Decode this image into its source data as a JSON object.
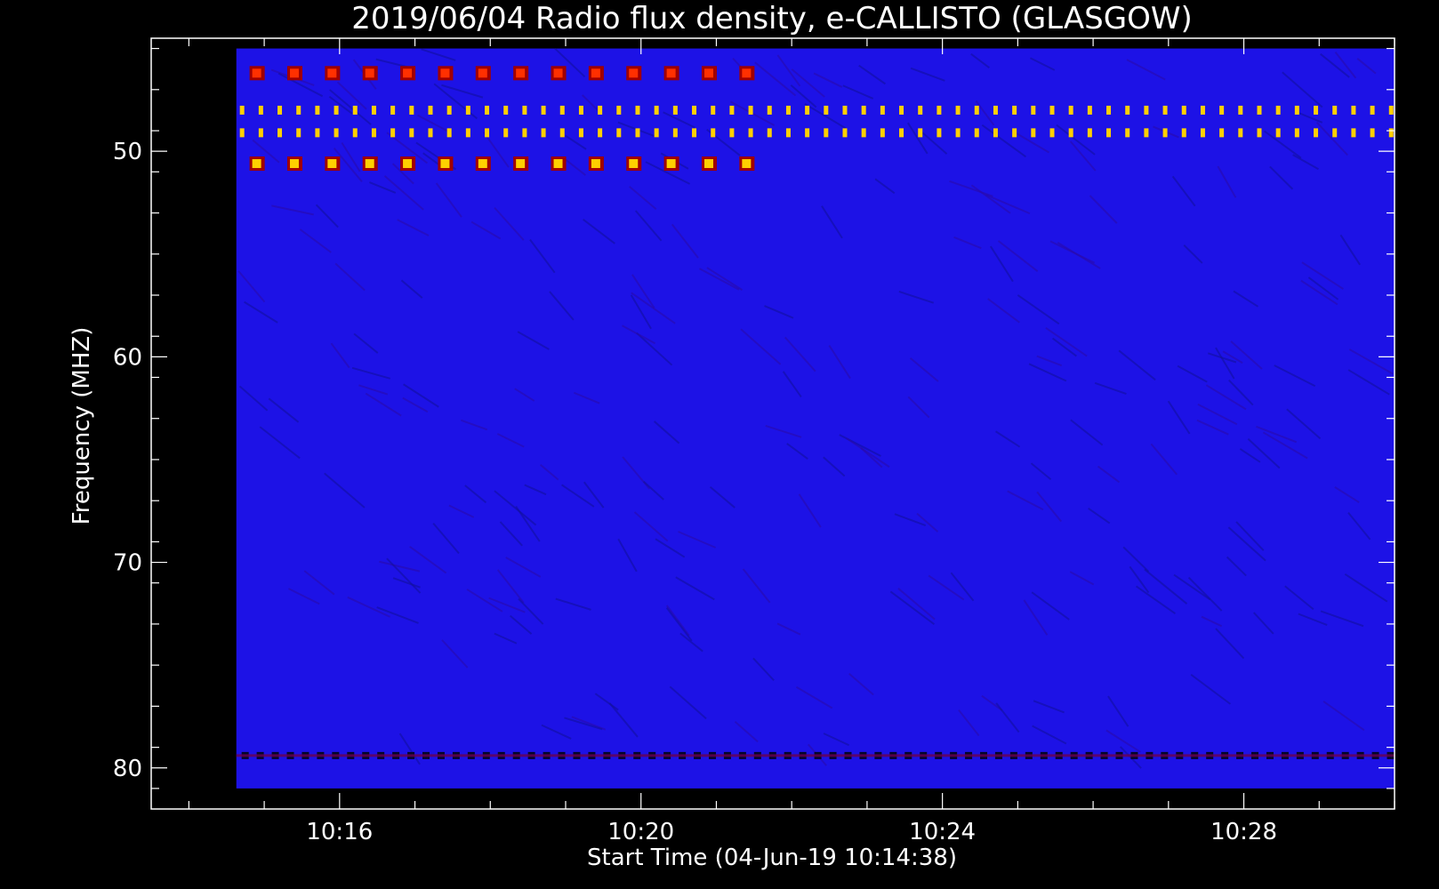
{
  "chart_data": {
    "type": "heatmap",
    "title": "2019/06/04  Radio flux density, e-CALLISTO (GLASGOW)",
    "xlabel": "Start Time (04-Jun-19 10:14:38)",
    "ylabel": "Frequency (MHZ)",
    "x_unit": "minutes after 10:00 UT",
    "xlim": [
      13.5,
      30
    ],
    "ylim": [
      44.5,
      82
    ],
    "y_inverted": true,
    "data_xlim": [
      14.63,
      30
    ],
    "data_ylim": [
      45,
      81
    ],
    "x_ticks": [
      {
        "value": 16,
        "label": "10:16"
      },
      {
        "value": 20,
        "label": "10:20"
      },
      {
        "value": 24,
        "label": "10:24"
      },
      {
        "value": 28,
        "label": "10:28"
      }
    ],
    "y_ticks": [
      {
        "value": 50,
        "label": "50"
      },
      {
        "value": 60,
        "label": "60"
      },
      {
        "value": 70,
        "label": "70"
      },
      {
        "value": 80,
        "label": "80"
      }
    ],
    "colors": {
      "background": "#1d12e6",
      "low": "#101060",
      "mid": "#a00000",
      "high": "#ff3000",
      "peak": "#ffd000"
    },
    "features": [
      {
        "name": "periodic burst row",
        "freq_mhz": 46.2,
        "t_start": 14.9,
        "t_end": 21.8,
        "period_min": 0.5,
        "color": "high"
      },
      {
        "name": "continuous emission line",
        "freq_mhz": 48.0,
        "t_start": 14.7,
        "t_end": 30,
        "period_min": 0.25,
        "color": "peak"
      },
      {
        "name": "continuous emission line",
        "freq_mhz": 49.1,
        "t_start": 14.7,
        "t_end": 30,
        "period_min": 0.25,
        "color": "peak"
      },
      {
        "name": "periodic burst row",
        "freq_mhz": 50.6,
        "t_start": 14.9,
        "t_end": 21.8,
        "period_min": 0.5,
        "color": "peak"
      },
      {
        "name": "interference band",
        "freq_mhz": 79.4,
        "t_start": 14.7,
        "t_end": 30,
        "period_min": 0.2,
        "color": "low"
      }
    ]
  }
}
